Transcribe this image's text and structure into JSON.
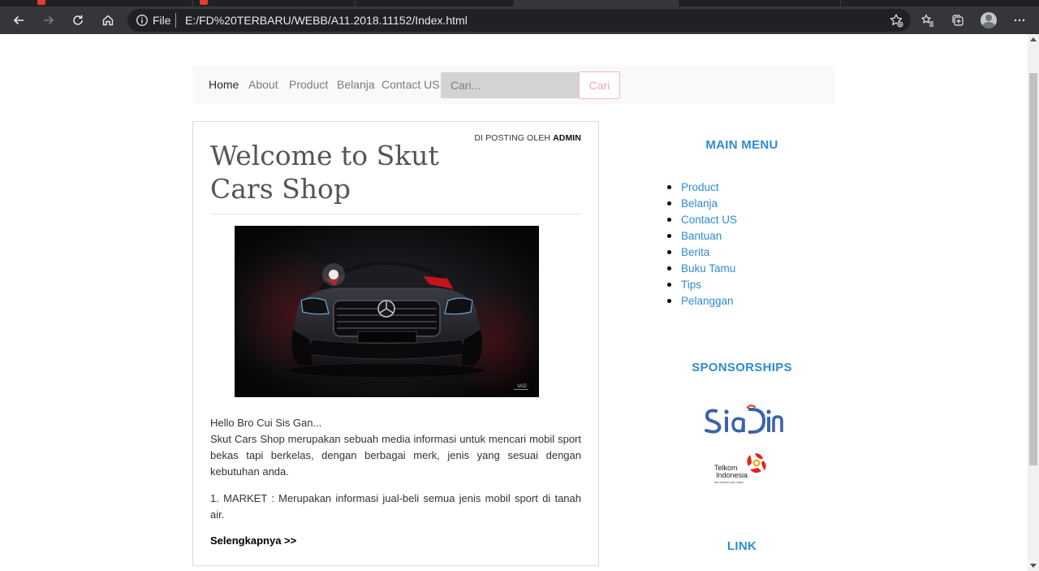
{
  "browser": {
    "scheme_label": "File",
    "url": "E:/FD%20TERBARU/WEBB/A11.2018.11152/Index.html"
  },
  "navbar": {
    "items": [
      {
        "label": "Home",
        "active": true
      },
      {
        "label": "About",
        "active": false
      },
      {
        "label": "Product",
        "active": false
      },
      {
        "label": "Belanja",
        "active": false
      },
      {
        "label": "Contact US",
        "active": false
      }
    ],
    "search_placeholder": "Cari...",
    "search_button": "Cari"
  },
  "post": {
    "meta_prefix": "DI POSTING OLEH",
    "meta_author": "ADMIN",
    "title": "Welcome to Skut Cars Shop",
    "greeting": "Hello Bro Cui Sis Gan...",
    "intro": "Skut Cars Shop merupakan sebuah media informasi untuk mencari mobil sport bekas tapi berkelas, dengan berbagai merk, jenis yang sesuai dengan kebutuhan anda.",
    "point1": "1. MARKET : Merupakan informasi jual-beli semua jenis mobil sport di tanah air.",
    "read_more": "Selengkapnya >>",
    "image_watermark": "VAD"
  },
  "sidebar": {
    "main_menu_title": "MAIN MENU",
    "main_menu": [
      "Product",
      "Belanja",
      "Contact US",
      "Bantuan",
      "Berita",
      "Buku Tamu",
      "Tips",
      "Pelanggan"
    ],
    "sponsorships_title": "SPONSORSHIPS",
    "sponsors": [
      {
        "name": "SiaDin",
        "logo_text": "SiaDin"
      },
      {
        "name": "Telkom Indonesia",
        "logo_text": "Telkom Indonesia",
        "tagline": "the world in your hand"
      }
    ],
    "link_title": "LINK"
  },
  "colors": {
    "accent": "#2e8ccf",
    "chrome_dark": "#35363a",
    "navbar_bg": "#f8f9fa",
    "search_button_border": "#f6b8c6"
  }
}
